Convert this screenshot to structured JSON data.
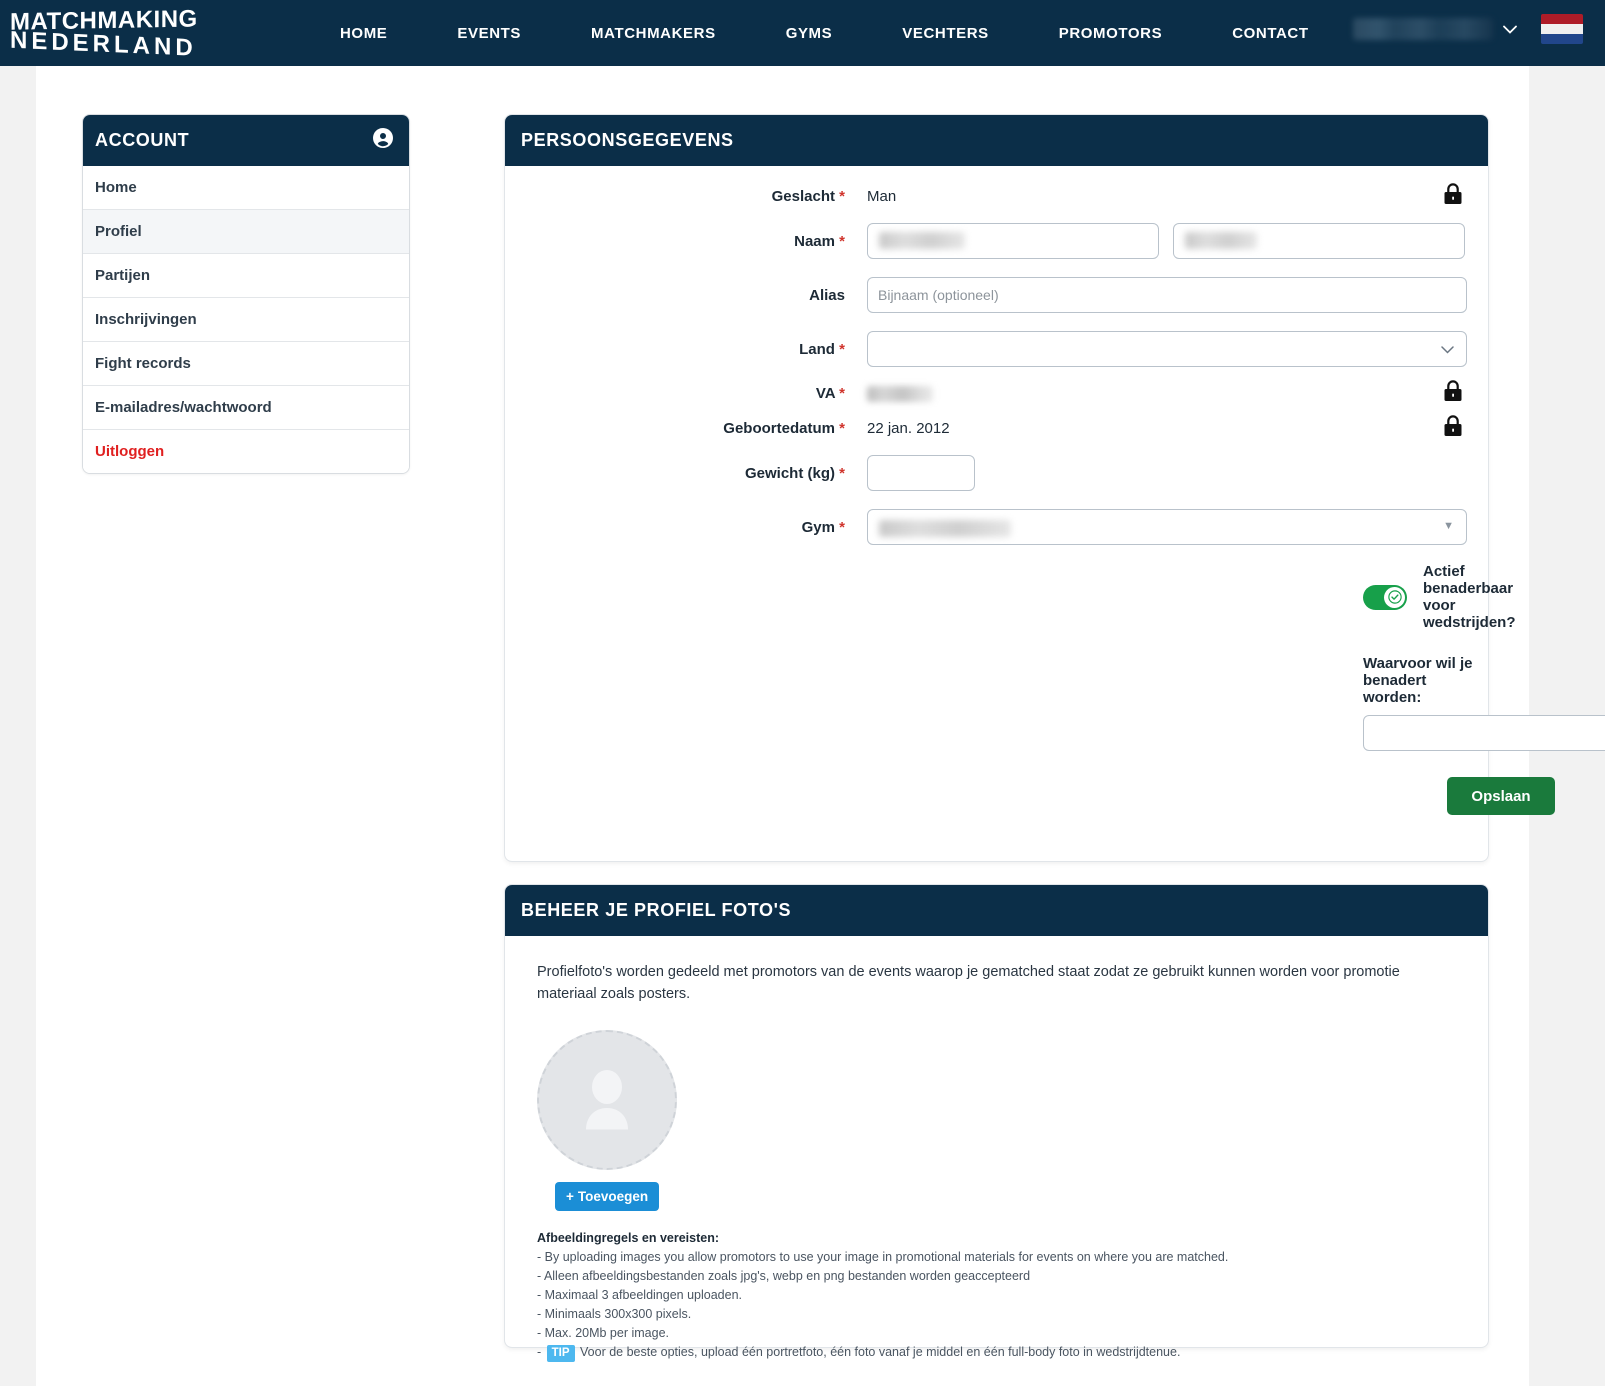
{
  "header": {
    "logo_line1": "MATCHMAKING",
    "logo_line2": "NEDERLAND",
    "nav": [
      {
        "label": "HOME"
      },
      {
        "label": "EVENTS"
      },
      {
        "label": "MATCHMAKERS"
      },
      {
        "label": "GYMS"
      },
      {
        "label": "VECHTERS"
      },
      {
        "label": "PROMOTORS"
      },
      {
        "label": "CONTACT"
      }
    ],
    "user_name_redacted": "",
    "chevron": "⌄",
    "flag_alt": "nl-flag"
  },
  "sidebar": {
    "title": "ACCOUNT",
    "items": [
      {
        "label": "Home"
      },
      {
        "label": "Profiel"
      },
      {
        "label": "Partijen"
      },
      {
        "label": "Inschrijvingen"
      },
      {
        "label": "Fight records"
      },
      {
        "label": "E-mailadres/wachtwoord"
      },
      {
        "label": "Uitloggen"
      }
    ]
  },
  "personal": {
    "title": "PERSOONSGEGEVENS",
    "labels": {
      "geslacht": "Geslacht",
      "naam": "Naam",
      "alias": "Alias",
      "land": "Land",
      "va": "VA",
      "geboortedatum": "Geboortedatum",
      "gewicht": "Gewicht (kg)",
      "gym": "Gym"
    },
    "required_marker": "*",
    "values": {
      "geslacht": "Man",
      "voornaam": "",
      "achternaam": "",
      "alias": "",
      "land": "",
      "va": "",
      "geboortedatum": "22 jan. 2012",
      "gewicht": "",
      "gym": "",
      "benadert_reden": ""
    },
    "placeholders": {
      "alias": "Bijnaam (optioneel)",
      "voornaam": "",
      "achternaam": "",
      "gewicht": "",
      "benadert_reden": ""
    },
    "toggle_label": "Actief benaderbaar voor wedstrijden?",
    "toggle_on": true,
    "benadert_label": "Waarvoor wil je benadert worden:",
    "save_label": "Opslaan"
  },
  "photos": {
    "title": "BEHEER JE PROFIEL FOTO'S",
    "intro": "Profielfoto's worden gedeeld met promotors van de events waarop je gematched staat zodat ze gebruikt kunnen worden voor promotie materiaal zoals posters.",
    "add_label": "Toevoegen",
    "add_plus": "+",
    "rules_title": "Afbeeldingregels en vereisten:",
    "rules": [
      "- By uploading images you allow promotors to use your image in promotional materials for events on where you are matched.",
      "- Alleen afbeeldingsbestanden zoals jpg's, webp en png bestanden worden geaccepteerd",
      "- Maximaal 3 afbeeldingen uploaden.",
      "- Minimaals 300x300 pixels.",
      "- Max. 20Mb per image."
    ],
    "tip_prefix": "-",
    "tip_badge": "TIP",
    "tip_text": "Voor de beste opties, upload één portretfoto, één foto vanaf je middel en één full-body foto in wedstrijdtenue."
  },
  "colors": {
    "navy": "#0b2e48",
    "green": "#1a7a3c",
    "toggle_green": "#17a04a",
    "blue": "#1b8ed6",
    "tip_blue": "#4db8ef",
    "red": "#e02020",
    "required": "#d0342c"
  }
}
